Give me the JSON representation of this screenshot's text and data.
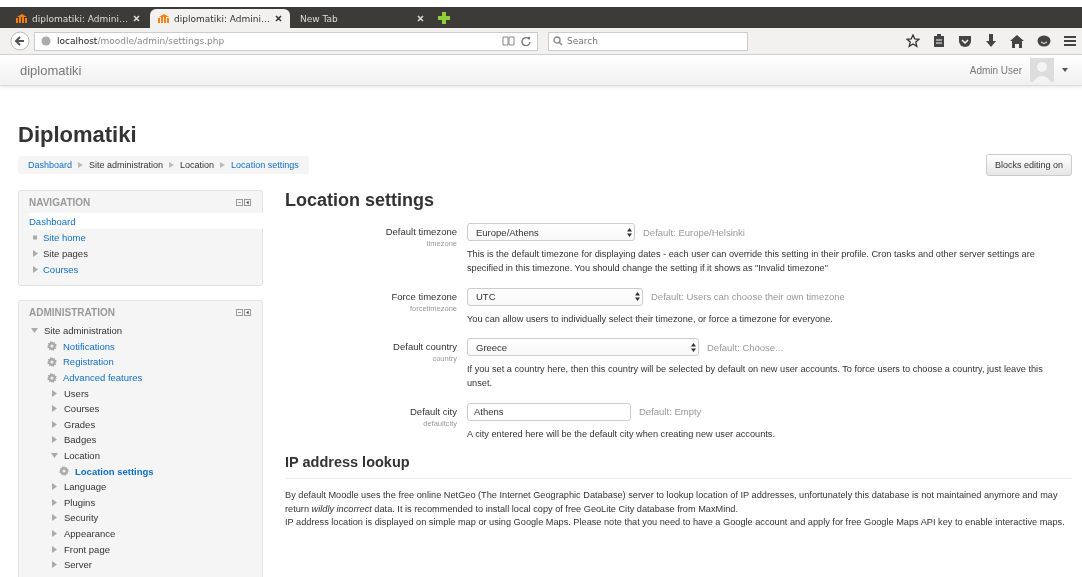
{
  "browser": {
    "tabs": [
      {
        "title": "diplomatiki: Admini…",
        "selected": false
      },
      {
        "title": "diplomatiki: Admini…",
        "selected": true
      },
      {
        "title": "New Tab",
        "selected": false
      }
    ],
    "url": {
      "host": "localhost",
      "path": "/moodle/admin/settings.php"
    },
    "search": {
      "placeholder": "Search"
    }
  },
  "navbar": {
    "brand": "diplomatiki",
    "user": "Admin User"
  },
  "page": {
    "heading": "Diplomatiki",
    "breadcrumb": [
      {
        "label": "Dashboard",
        "link": true
      },
      {
        "label": "Site administration",
        "link": false
      },
      {
        "label": "Location",
        "link": false
      },
      {
        "label": "Location settings",
        "link": true
      }
    ],
    "edit_button": "Blocks editing on"
  },
  "navigation": {
    "title": "NAVIGATION",
    "items": [
      {
        "label": "Dashboard",
        "kind": "root",
        "link": true
      },
      {
        "label": "Site home",
        "kind": "leaf",
        "link": true
      },
      {
        "label": "Site pages",
        "kind": "branch",
        "link": false
      },
      {
        "label": "Courses",
        "kind": "branch",
        "link": true
      }
    ]
  },
  "administration": {
    "title": "ADMINISTRATION",
    "items": [
      {
        "label": "Site administration",
        "kind": "branch",
        "expanded": true,
        "selected": false,
        "children": [
          {
            "label": "Notifications",
            "kind": "page",
            "selected": false
          },
          {
            "label": "Registration",
            "kind": "page",
            "selected": false
          },
          {
            "label": "Advanced features",
            "kind": "page",
            "selected": false
          },
          {
            "label": "Users",
            "kind": "branch",
            "expanded": false,
            "selected": false
          },
          {
            "label": "Courses",
            "kind": "branch",
            "expanded": false,
            "selected": false
          },
          {
            "label": "Grades",
            "kind": "branch",
            "expanded": false,
            "selected": false
          },
          {
            "label": "Badges",
            "kind": "branch",
            "expanded": false,
            "selected": false
          },
          {
            "label": "Location",
            "kind": "branch",
            "expanded": true,
            "selected": false,
            "children": [
              {
                "label": "Location settings",
                "kind": "page",
                "selected": true
              }
            ]
          },
          {
            "label": "Language",
            "kind": "branch",
            "expanded": false,
            "selected": false
          },
          {
            "label": "Plugins",
            "kind": "branch",
            "expanded": false,
            "selected": false
          },
          {
            "label": "Security",
            "kind": "branch",
            "expanded": false,
            "selected": false
          },
          {
            "label": "Appearance",
            "kind": "branch",
            "expanded": false,
            "selected": false
          },
          {
            "label": "Front page",
            "kind": "branch",
            "expanded": false,
            "selected": false
          },
          {
            "label": "Server",
            "kind": "branch",
            "expanded": false,
            "selected": false
          }
        ]
      }
    ]
  },
  "settings": {
    "title": "Location settings",
    "items": [
      {
        "label": "Default timezone",
        "name": "timezone",
        "kind": "select",
        "value": "Europe/Athens",
        "default": "Default: Europe/Helsinki",
        "description": "This is the default timezone for displaying dates - each user can override this setting in their profile. Cron tasks and other server settings are specified in this timezone. You should change the setting if it shows as \"Invalid timezone\""
      },
      {
        "label": "Force timezone",
        "name": "forcetimezone",
        "kind": "select",
        "value": "UTC",
        "default": "Default: Users can choose their own timezone",
        "description": "You can allow users to individually select their timezone, or force a timezone for everyone."
      },
      {
        "label": "Default country",
        "name": "country",
        "kind": "select",
        "value": "Greece",
        "default": "Default: Choose...",
        "description": "If you set a country here, then this country will be selected by default on new user accounts. To force users to choose a country, just leave this unset."
      },
      {
        "label": "Default city",
        "name": "defaultcity",
        "kind": "text",
        "value": "Athens",
        "default": "Default: Empty",
        "description": "A city entered here will be the default city when creating new user accounts."
      }
    ]
  },
  "ip_lookup": {
    "title": "IP address lookup",
    "paragraphs": [
      "By default Moodle uses the free online NetGeo (The Internet Geographic Database) server to lookup location of IP addresses, unfortunately this database is not maintained anymore and may return *wildly incorrect* data. It is recommended to install local copy of free GeoLite City database from MaxMind.",
      "IP address location is displayed on simple map or using Google Maps. Please note that you need to have a Google account and apply for free Google Maps API key to enable interactive maps."
    ]
  }
}
